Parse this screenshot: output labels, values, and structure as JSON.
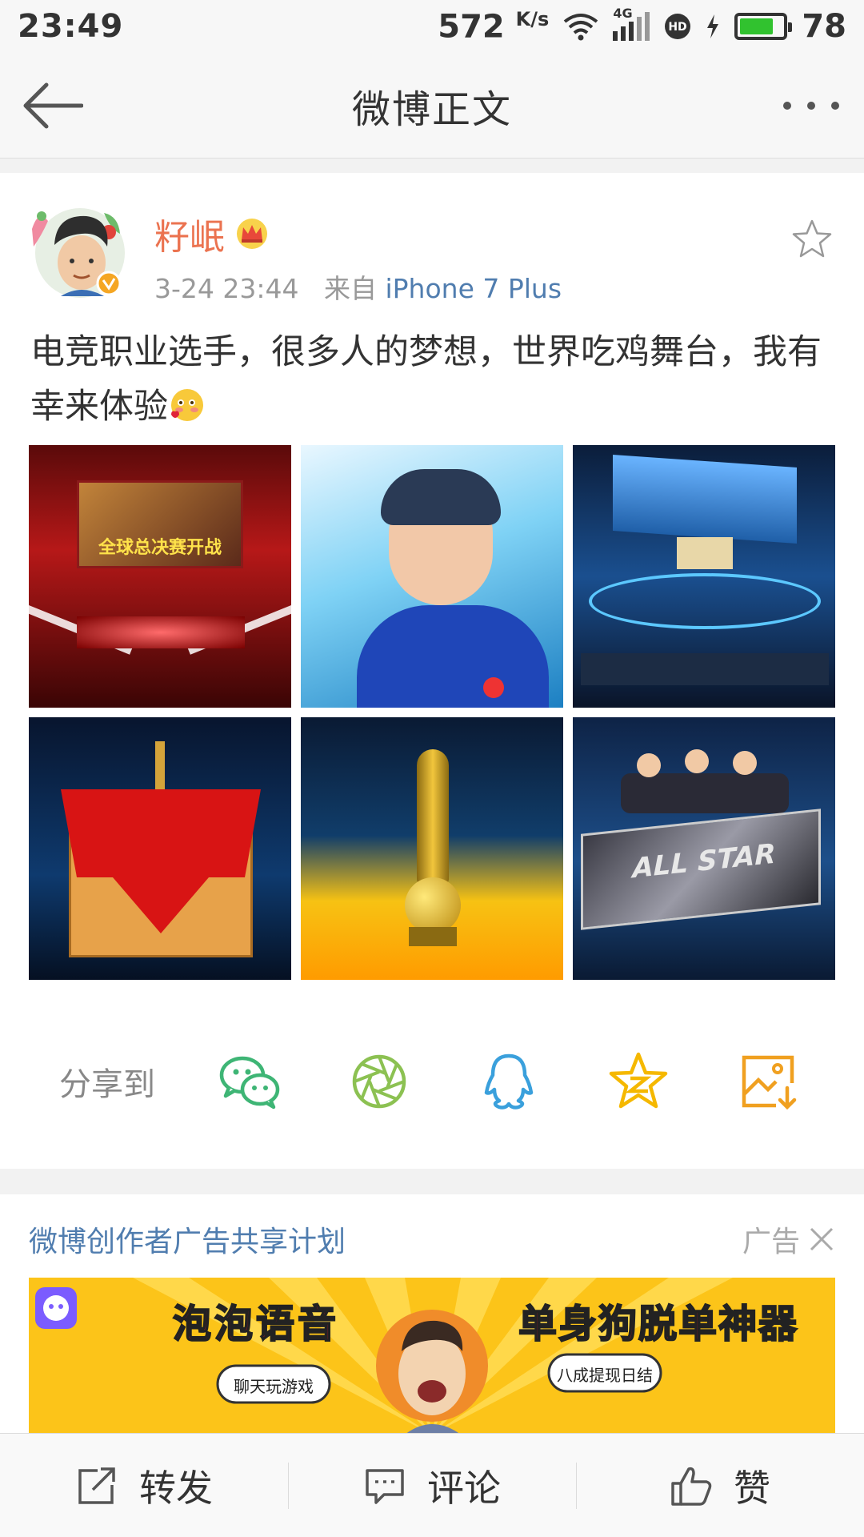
{
  "status_bar": {
    "time": "23:49",
    "net_speed": "572",
    "net_unit": "K/s",
    "network": "4G",
    "battery": "78",
    "battery_color": "#31c22f"
  },
  "nav": {
    "back_icon": "arrow-left-icon",
    "title": "微博正文",
    "more_icon": "more-dots-icon"
  },
  "post": {
    "username": "籽岷",
    "badge_icon": "crown-icon",
    "verified_icon": "verified-v-icon",
    "time": "3-24 23:44",
    "from_prefix": "来自",
    "source": "iPhone 7 Plus",
    "text": "电竞职业选手，很多人的梦想，世界吃鸡舞台，我有幸来体验",
    "emoji_icon": "blush-heart-emoji-icon",
    "favorite_icon": "star-outline-icon",
    "photos": [
      {
        "desc": "stage-screen",
        "caption": "全球总决赛开战"
      },
      {
        "desc": "selfie",
        "caption": ""
      },
      {
        "desc": "arena-stage",
        "caption": ""
      },
      {
        "desc": "airdrop-crate",
        "caption": ""
      },
      {
        "desc": "trophy",
        "caption": ""
      },
      {
        "desc": "all-star-desk",
        "caption": "ALL STAR"
      }
    ]
  },
  "share": {
    "label": "分享到",
    "targets": [
      "wechat-icon",
      "moments-icon",
      "qq-icon",
      "qzone-icon",
      "save-image-icon"
    ],
    "colors": {
      "wechat": "#3eb575",
      "moments": "#8cc152",
      "qq": "#3aa0dc",
      "qzone": "#f5b800",
      "save": "#f0a020"
    }
  },
  "ad": {
    "title": "微博创作者广告共享计划",
    "tag": "广告",
    "close_icon": "close-x-icon",
    "banner": {
      "left_text": "泡泡语音",
      "right_text": "单身狗脱单神器",
      "bubble_left": "聊天玩游戏",
      "bubble_right": "八成提现日结"
    }
  },
  "bottom_bar": {
    "repost": "转发",
    "comment": "评论",
    "like": "赞"
  }
}
